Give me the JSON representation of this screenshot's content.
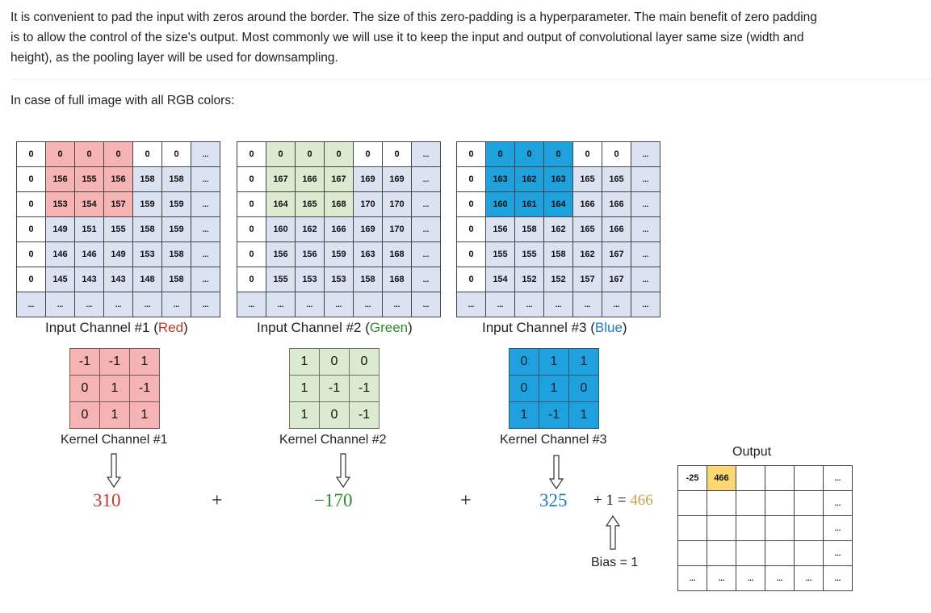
{
  "paragraph": "It is convenient to pad the input with zeros around the border. The size of this zero-padding is a hyperparameter. The main benefit of zero padding is to allow the control of the size's output. Most commonly we will use it to keep the input and output of convolutional layer same size (width and height), as the pooling layer will be used for downsampling.",
  "intro": "In case of full image with all RGB colors:",
  "channels": [
    {
      "label_prefix": "Input Channel #1 (",
      "color_name": "Red",
      "label_suffix": ")",
      "rows": [
        [
          "0",
          "0",
          "0",
          "0",
          "0",
          "0",
          "..."
        ],
        [
          "0",
          "156",
          "155",
          "156",
          "158",
          "158",
          "..."
        ],
        [
          "0",
          "153",
          "154",
          "157",
          "159",
          "159",
          "..."
        ],
        [
          "0",
          "149",
          "151",
          "155",
          "158",
          "159",
          "..."
        ],
        [
          "0",
          "146",
          "146",
          "149",
          "153",
          "158",
          "..."
        ],
        [
          "0",
          "145",
          "143",
          "143",
          "148",
          "158",
          "..."
        ],
        [
          "...",
          "...",
          "...",
          "...",
          "...",
          "...",
          "..."
        ]
      ],
      "kernel_label": "Kernel Channel #1",
      "kernel": [
        [
          "-1",
          "-1",
          "1"
        ],
        [
          "0",
          "1",
          "-1"
        ],
        [
          "0",
          "1",
          "1"
        ]
      ],
      "result": "310"
    },
    {
      "label_prefix": "Input Channel #2 (",
      "color_name": "Green",
      "label_suffix": ")",
      "rows": [
        [
          "0",
          "0",
          "0",
          "0",
          "0",
          "0",
          "..."
        ],
        [
          "0",
          "167",
          "166",
          "167",
          "169",
          "169",
          "..."
        ],
        [
          "0",
          "164",
          "165",
          "168",
          "170",
          "170",
          "..."
        ],
        [
          "0",
          "160",
          "162",
          "166",
          "169",
          "170",
          "..."
        ],
        [
          "0",
          "156",
          "156",
          "159",
          "163",
          "168",
          "..."
        ],
        [
          "0",
          "155",
          "153",
          "153",
          "158",
          "168",
          "..."
        ],
        [
          "...",
          "...",
          "...",
          "...",
          "...",
          "...",
          "..."
        ]
      ],
      "kernel_label": "Kernel Channel #2",
      "kernel": [
        [
          "1",
          "0",
          "0"
        ],
        [
          "1",
          "-1",
          "-1"
        ],
        [
          "1",
          "0",
          "-1"
        ]
      ],
      "result": "−170"
    },
    {
      "label_prefix": "Input Channel #3 (",
      "color_name": "Blue",
      "label_suffix": ")",
      "rows": [
        [
          "0",
          "0",
          "0",
          "0",
          "0",
          "0",
          "..."
        ],
        [
          "0",
          "163",
          "162",
          "163",
          "165",
          "165",
          "..."
        ],
        [
          "0",
          "160",
          "161",
          "164",
          "166",
          "166",
          "..."
        ],
        [
          "0",
          "156",
          "158",
          "162",
          "165",
          "166",
          "..."
        ],
        [
          "0",
          "155",
          "155",
          "158",
          "162",
          "167",
          "..."
        ],
        [
          "0",
          "154",
          "152",
          "152",
          "157",
          "167",
          "..."
        ],
        [
          "...",
          "...",
          "...",
          "...",
          "...",
          "...",
          "..."
        ]
      ],
      "kernel_label": "Kernel Channel #3",
      "kernel": [
        [
          "0",
          "1",
          "1"
        ],
        [
          "0",
          "1",
          "0"
        ],
        [
          "1",
          "-1",
          "1"
        ]
      ],
      "result": "325"
    }
  ],
  "plus_sign": "+",
  "bias_term": "+ 1 = ",
  "final_value": "466",
  "bias_label": "Bias = 1",
  "output": {
    "title": "Output",
    "rows": [
      [
        "-25",
        "466",
        "",
        "",
        "",
        "..."
      ],
      [
        "",
        "",
        "",
        "",
        "",
        "..."
      ],
      [
        "",
        "",
        "",
        "",
        "",
        "..."
      ],
      [
        "",
        "",
        "",
        "",
        "",
        "..."
      ],
      [
        "...",
        "...",
        "...",
        "...",
        "...",
        "..."
      ]
    ]
  },
  "colors": {
    "red_fill": "#f6b3b3",
    "green_fill": "#dcebd0",
    "blue_fill": "#1ea1dc",
    "padding_fill": "#dbe3f3",
    "output_highlight": "#fcd772",
    "red_text": "#c0392b",
    "green_text": "#2e8b30",
    "blue_text": "#1e7bc4",
    "gold_text": "#c9a04a"
  }
}
